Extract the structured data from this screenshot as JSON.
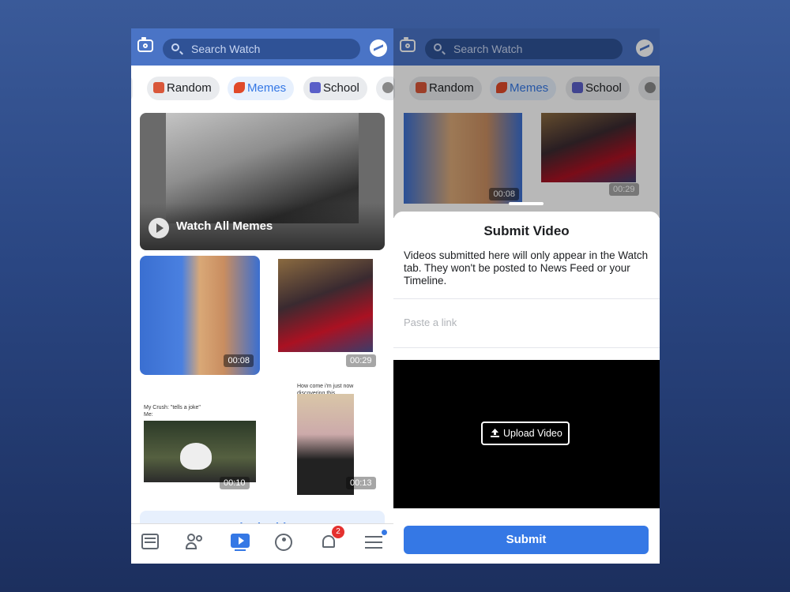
{
  "watch": {
    "search_placeholder": "Search Watch",
    "chips": [
      {
        "label": "Random",
        "active": false
      },
      {
        "label": "Memes",
        "active": true
      },
      {
        "label": "School",
        "active": false
      }
    ]
  },
  "left": {
    "hero_label": "Watch All Memes",
    "videos": [
      {
        "duration": "00:08"
      },
      {
        "duration": "00:29"
      },
      {
        "caption": "My Crush: \"tells a joke\"\nMe:",
        "duration": "00:10"
      },
      {
        "caption": "How come i'm just now\ndiscovering this",
        "duration": "00:13"
      }
    ],
    "submit_label": "Submit Video",
    "nav": {
      "notifications_badge": "2"
    }
  },
  "right": {
    "durations": [
      "00:08",
      "00:29"
    ],
    "sheet": {
      "title": "Submit Video",
      "description": "Videos submitted here will only appear in the Watch tab. They won't be posted to News Feed or your Timeline.",
      "link_placeholder": "Paste a link",
      "upload_label": "Upload Video",
      "submit_label": "Submit"
    }
  },
  "colors": {
    "brand_blue": "#4a74c6",
    "accent": "#3578e5",
    "badge": "#e4312f"
  }
}
